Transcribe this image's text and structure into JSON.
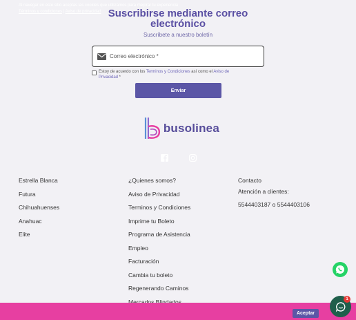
{
  "newsletter": {
    "title_line1": "Suscribirse mediante correo",
    "title_line2": "electrónico",
    "subtitle": "Suscríbete a nuestro boletín",
    "email_placeholder": "Correo electrónico *",
    "consent_prefix": "Estoy de acuerdo con los ",
    "consent_terms": "Terminos y Condiciones",
    "consent_middle": " así como el ",
    "consent_privacy": "Aviso de Privacidad",
    "consent_suffix": " *",
    "submit_label": "Enviar"
  },
  "brand": {
    "name": "busolinea",
    "colors": {
      "primary": "#564c9a",
      "accent": "#e73fa1"
    }
  },
  "social": {
    "icons": [
      "facebook-icon",
      "instagram-icon"
    ]
  },
  "footer": {
    "column1": [
      "Estrella Blanca",
      "Futura",
      "Chihuahuenses",
      "Anahuac",
      "Elite"
    ],
    "column2": [
      "¿Quienes somos?",
      "Aviso de Privacidad",
      "Terminos y Condiciones",
      "Imprime tu Boleto",
      "Programa de Asistencia",
      "Empleo",
      "Facturación",
      "Cambia tu boleto",
      "Regenerando Caminos",
      "Mercados Blindados"
    ],
    "column3": [
      "Contacto",
      "Atención a clientes:",
      "5544403187 o 5544403106"
    ]
  },
  "cookies": {
    "message": "Al navegar en este sitio aceptas las cookies que utilizamos para mejorar tu experiencia",
    "terms_link": "Términos y condiciones",
    "separator": " | ",
    "privacy_link": "Aviso de privacidad",
    "accept_label": "Aceptar"
  },
  "chat": {
    "badge_count": "1"
  }
}
